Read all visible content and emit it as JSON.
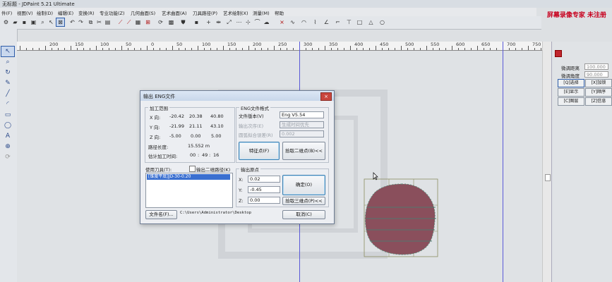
{
  "window": {
    "title": "无标题 - JDPaint 5.21 Ultimate"
  },
  "watermark": "屏幕录像专家 未注册",
  "menu": [
    "件(F)",
    "视图(V)",
    "绘制(D)",
    "编辑(E)",
    "变换(R)",
    "专业功能(Z)",
    "几何曲面(S)",
    "艺术曲面(A)",
    "刀具路径(P)",
    "艺术绘制(X)",
    "测量(M)",
    "帮助"
  ],
  "icons": {
    "toolbar": [
      "gear-icon",
      "open-icon",
      "save-icon",
      "print-icon",
      "search-icon",
      "pointer-icon",
      "select-box-icon",
      "undo-icon",
      "redo-icon",
      "copy-icon",
      "cut-icon",
      "paste-icon",
      "mirror-icon",
      "array-icon",
      "transform-icon",
      "scale-icon",
      "rotate-icon",
      "grid-icon",
      "layer-icon",
      "shield-icon",
      "node-icon",
      "align-icon",
      "distribute-icon",
      "ellipsis-icon",
      "ruler-icon",
      "join-icon",
      "cloud-icon",
      "cross-icon",
      "curve-icon",
      "arc-icon",
      "spline-icon",
      "angle-icon",
      "text-icon",
      "square-icon",
      "triangle-icon",
      "circle-icon"
    ],
    "left": [
      "edit-node-icon",
      "zoom-icon",
      "rotate-view-icon",
      "pen-icon",
      "line-icon",
      "arc-icon",
      "rectangle-icon",
      "ellipse-icon",
      "text-icon",
      "zoom-in-icon",
      "refresh-icon"
    ]
  },
  "ruler": {
    "labels": [
      "200",
      "150",
      "100",
      "50",
      "0",
      "50",
      "100",
      "150",
      "200",
      "250",
      "300",
      "350",
      "400",
      "450",
      "500",
      "550",
      "600",
      "650",
      "700",
      "750",
      "800"
    ]
  },
  "right_panel": {
    "fine_distance_label": "微调距离",
    "fine_distance": "100.000",
    "fine_angle_label": "微调角度",
    "fine_angle": "90.000",
    "buttons": [
      "[Q]选择",
      "[X]加锁",
      "[E]显示",
      "[Y]顺序",
      "[C]图层",
      "[Z]信息"
    ]
  },
  "dialog": {
    "title": "输出 ENG文件",
    "close": "×",
    "range": {
      "title": "加工范围",
      "x_label": "X 向:",
      "x_min": "-20.42",
      "x_size": "20.38",
      "x_max": "40.80",
      "y_label": "Y 向:",
      "y_min": "-21.99",
      "y_size": "21.11",
      "y_max": "43.10",
      "z_label": "Z 向:",
      "z_min": "-5.00",
      "z_size": "0.00",
      "z_max": "5.00",
      "path_len_label": "路径长度:",
      "path_len": "15.552 m",
      "time_label": "估计加工时间:",
      "time_h": "00",
      "time_m": "49",
      "time_s": "16"
    },
    "eng": {
      "title": "ENG文件格式",
      "version_label": "文件版本(V)",
      "version": "Eng V5.54",
      "order_label": "输出次序(E)",
      "order": "生成时间优先",
      "precision_label": "圆弧拟合误差(R)",
      "precision": "0.002"
    },
    "feature_button": "特征点(F)",
    "pick_button": "拾取二维点(B)<<",
    "tools": {
      "title": "使用刀具(T):",
      "items": [
        "[锥度平底]JD-30-0.20"
      ]
    },
    "output_2d_label": "输出二维路径(K)",
    "origin": {
      "title": "输出原点",
      "x_label": "X:",
      "x": "0.02",
      "y_label": "Y:",
      "y": "-0.45",
      "z_label": "Z:",
      "z": "0.00"
    },
    "ok_button": "确定(O)",
    "pick3_button": "拾取三维点(P)<<",
    "filename_button": "文件名(F)...",
    "path": "C:\\Users\\Administrator\\Desktop",
    "cancel_button": "取消(C)"
  }
}
